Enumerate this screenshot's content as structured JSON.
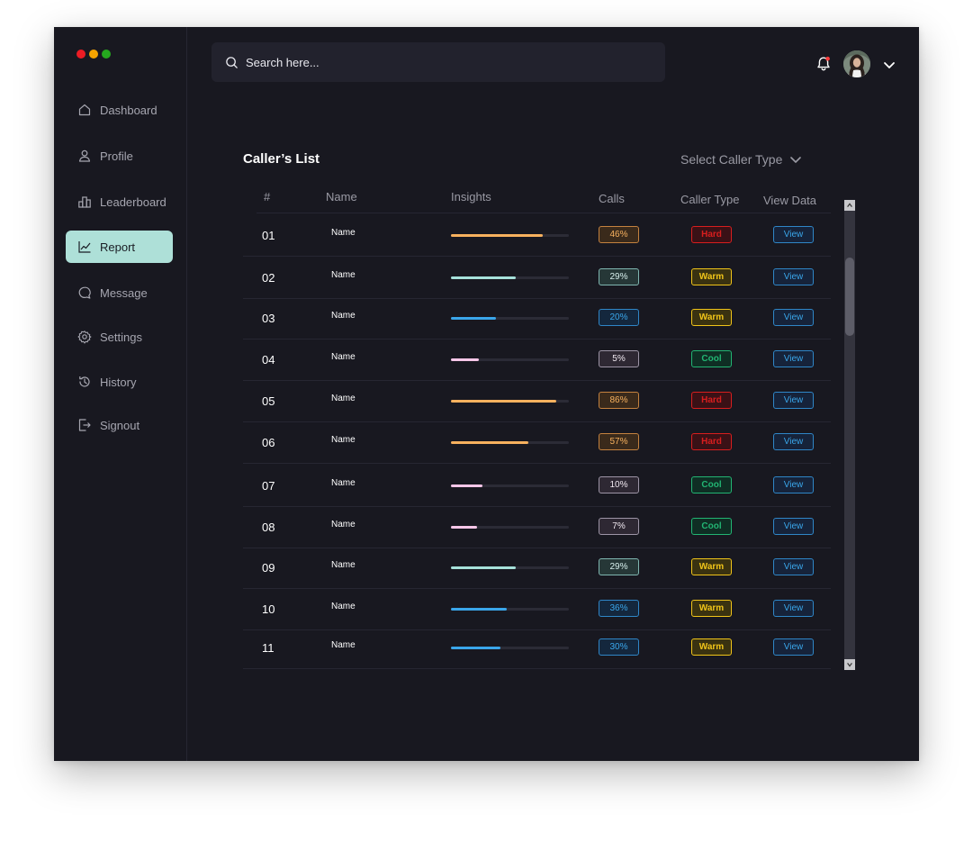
{
  "window_controls": {
    "colors": [
      "#ec1c24",
      "#f5a300",
      "#25a81e"
    ]
  },
  "nav": [
    {
      "label": "Dashboard",
      "icon": "home-icon"
    },
    {
      "label": "Profile",
      "icon": "user-icon"
    },
    {
      "label": "Leaderboard",
      "icon": "leaderboard-icon"
    },
    {
      "label": "Report",
      "icon": "chart-line-icon",
      "active": true
    },
    {
      "label": "Message",
      "icon": "message-icon"
    },
    {
      "label": "Settings",
      "icon": "gear-icon"
    },
    {
      "label": "History",
      "icon": "history-icon"
    },
    {
      "label": "Signout",
      "icon": "signout-icon"
    }
  ],
  "search": {
    "placeholder": "Search here..."
  },
  "header": {
    "bell_icon": "bell-icon",
    "notification_dot_color": "#ff3b3b"
  },
  "list": {
    "title": "Caller’s List",
    "select_label": "Select Caller Type",
    "columns": {
      "num": "#",
      "name": "Name",
      "insights": "Insights",
      "calls": "Calls",
      "caller_type": "Caller Type",
      "view_data": "View Data"
    }
  },
  "colors": {
    "accent": "#aee0d8",
    "insight_colors": {
      "orange": "#f7b15e",
      "teal": "#a6e1da",
      "blue": "#3aa6ea",
      "pink": "#f6c6e8"
    },
    "type_colors": {
      "Hard": "#d81e1e",
      "Warm": "#f0c419",
      "Cool": "#22b573"
    }
  },
  "rows": [
    {
      "num": "01",
      "name": "Name",
      "insight": 0.78,
      "color": "orange",
      "calls": "46%",
      "type": "Hard",
      "view": "View"
    },
    {
      "num": "02",
      "name": "Name",
      "insight": 0.55,
      "color": "teal",
      "calls": "29%",
      "type": "Warm",
      "view": "View"
    },
    {
      "num": "03",
      "name": "Name",
      "insight": 0.38,
      "color": "blue",
      "calls": "20%",
      "type": "Warm",
      "view": "View"
    },
    {
      "num": "04",
      "name": "Name",
      "insight": 0.24,
      "color": "pink",
      "calls": "5%",
      "type": "Cool",
      "view": "View"
    },
    {
      "num": "05",
      "name": "Name",
      "insight": 0.89,
      "color": "orange",
      "calls": "86%",
      "type": "Hard",
      "view": "View"
    },
    {
      "num": "06",
      "name": "Name",
      "insight": 0.66,
      "color": "orange",
      "calls": "57%",
      "type": "Hard",
      "view": "View"
    },
    {
      "num": "07",
      "name": "Name",
      "insight": 0.27,
      "color": "pink",
      "calls": "10%",
      "type": "Cool",
      "view": "View"
    },
    {
      "num": "08",
      "name": "Name",
      "insight": 0.22,
      "color": "pink",
      "calls": "7%",
      "type": "Cool",
      "view": "View"
    },
    {
      "num": "09",
      "name": "Name",
      "insight": 0.55,
      "color": "teal",
      "calls": "29%",
      "type": "Warm",
      "view": "View"
    },
    {
      "num": "10",
      "name": "Name",
      "insight": 0.47,
      "color": "blue",
      "calls": "36%",
      "type": "Warm",
      "view": "View"
    },
    {
      "num": "11",
      "name": "Name",
      "insight": 0.42,
      "color": "blue",
      "calls": "30%",
      "type": "Warm",
      "view": "View"
    }
  ]
}
